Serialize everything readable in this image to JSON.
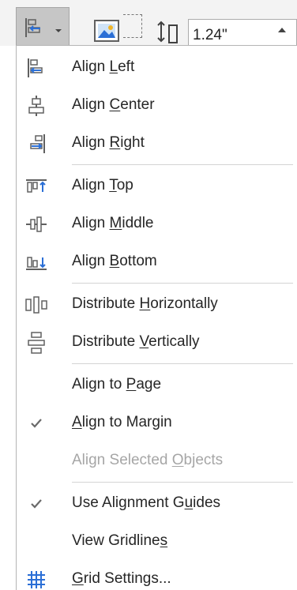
{
  "ribbon": {
    "size_value": "1.24\""
  },
  "menu": {
    "items": [
      {
        "id": "align-left",
        "pre": "Align ",
        "key": "L",
        "post": "eft",
        "icon": "align-left-icon",
        "checked": false,
        "disabled": false
      },
      {
        "id": "align-center",
        "pre": "Align ",
        "key": "C",
        "post": "enter",
        "icon": "align-center-icon",
        "checked": false,
        "disabled": false
      },
      {
        "id": "align-right",
        "pre": "Align ",
        "key": "R",
        "post": "ight",
        "icon": "align-right-icon",
        "checked": false,
        "disabled": false
      },
      {
        "id": "align-top",
        "pre": "Align ",
        "key": "T",
        "post": "op",
        "icon": "align-top-icon",
        "checked": false,
        "disabled": false
      },
      {
        "id": "align-middle",
        "pre": "Align ",
        "key": "M",
        "post": "iddle",
        "icon": "align-middle-icon",
        "checked": false,
        "disabled": false
      },
      {
        "id": "align-bottom",
        "pre": "Align ",
        "key": "B",
        "post": "ottom",
        "icon": "align-bottom-icon",
        "checked": false,
        "disabled": false
      },
      {
        "id": "distribute-horizontally",
        "pre": "Distribute ",
        "key": "H",
        "post": "orizontally",
        "icon": "distribute-horizontally-icon",
        "checked": false,
        "disabled": false
      },
      {
        "id": "distribute-vertically",
        "pre": "Distribute ",
        "key": "V",
        "post": "ertically",
        "icon": "distribute-vertically-icon",
        "checked": false,
        "disabled": false
      },
      {
        "id": "align-to-page",
        "pre": "Align to ",
        "key": "P",
        "post": "age",
        "icon": "",
        "checked": false,
        "disabled": false
      },
      {
        "id": "align-to-margin",
        "pre": "",
        "key": "A",
        "post": "lign to Margin",
        "icon": "checkmark-icon",
        "checked": true,
        "disabled": false
      },
      {
        "id": "align-selected-objects",
        "pre": "Align Selected ",
        "key": "O",
        "post": "bjects",
        "icon": "",
        "checked": false,
        "disabled": true
      },
      {
        "id": "use-alignment-guides",
        "pre": "Use Alignment G",
        "key": "u",
        "post": "ides",
        "icon": "checkmark-icon",
        "checked": true,
        "disabled": false
      },
      {
        "id": "view-gridlines",
        "pre": "View Gridline",
        "key": "s",
        "post": "",
        "icon": "",
        "checked": false,
        "disabled": false
      },
      {
        "id": "grid-settings",
        "pre": "",
        "key": "G",
        "post": "rid Settings...",
        "icon": "grid-icon",
        "checked": false,
        "disabled": false
      }
    ]
  },
  "colors": {
    "icon_blue": "#2b6fd6",
    "icon_gray": "#606060",
    "disabled_text": "#a6a6a6"
  }
}
